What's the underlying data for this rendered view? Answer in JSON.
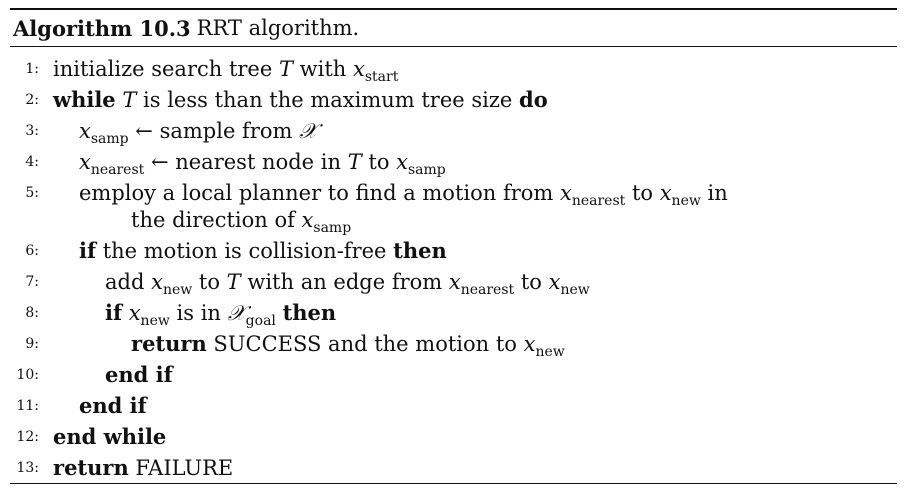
{
  "algorithm": {
    "label": "Algorithm 10.3",
    "title": "RRT algorithm."
  },
  "lines": [
    {
      "no": "1:",
      "a": "initialize search tree ",
      "T": "T",
      "b": " with ",
      "x": "x",
      "sub": "start"
    },
    {
      "no": "2:",
      "kw1": "while",
      "T": "T",
      "a": " is less than the maximum tree size ",
      "kw2": "do"
    },
    {
      "no": "3:",
      "x": "x",
      "sub": "samp",
      "a": " ← sample from ",
      "X": "𝒳"
    },
    {
      "no": "4:",
      "x": "x",
      "sub": "nearest",
      "a": " ← nearest node in ",
      "T": "T",
      "b": " to ",
      "x2": "x",
      "sub2": "samp"
    },
    {
      "no": "5:",
      "a": "employ a local planner to find a motion from ",
      "x": "x",
      "sub": "nearest",
      "b": " to ",
      "x2": "x",
      "sub2": "new",
      "c": " in",
      "d": "the direction of ",
      "x3": "x",
      "sub3": "samp"
    },
    {
      "no": "6:",
      "kw1": "if",
      "a": " the motion is collision-free ",
      "kw2": "then"
    },
    {
      "no": "7:",
      "a": "add ",
      "x": "x",
      "sub": "new",
      "b": " to ",
      "T": "T",
      "c": " with an edge from ",
      "x2": "x",
      "sub2": "nearest",
      "d": " to ",
      "x3": "x",
      "sub3": "new"
    },
    {
      "no": "8:",
      "kw1": "if",
      "x": "x",
      "sub": "new",
      "a": " is in ",
      "X": "𝒳",
      "sub2": "goal",
      "kw2": "then"
    },
    {
      "no": "9:",
      "kw1": "return",
      "a": "SUCCESS and the motion to ",
      "x": "x",
      "sub": "new"
    },
    {
      "no": "10:",
      "kw1": "end if"
    },
    {
      "no": "11:",
      "kw1": "end if"
    },
    {
      "no": "12:",
      "kw1": "end while"
    },
    {
      "no": "13:",
      "kw1": "return",
      "a": "FAILURE"
    }
  ]
}
